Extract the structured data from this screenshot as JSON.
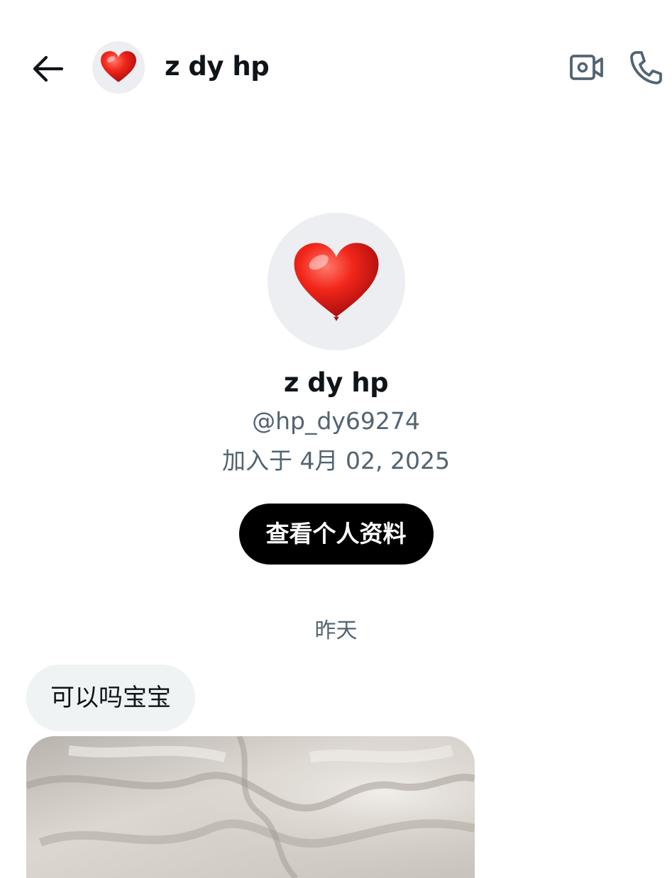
{
  "header": {
    "name": "z dy hp",
    "back_icon": "arrow-left-icon",
    "video_icon": "video-camera-icon",
    "call_icon": "phone-icon"
  },
  "profile": {
    "avatar_icon": "red-heart-icon",
    "name": "z dy hp",
    "handle": "@hp_dy69274",
    "joined": "加入于 4月 02, 2025",
    "view_profile_label": "查看个人资料"
  },
  "conversation": {
    "date_label": "昨天",
    "messages": [
      {
        "text": "可以吗宝宝"
      }
    ]
  },
  "colors": {
    "secondary_text": "#536471",
    "bubble_bg": "#eff3f4",
    "avatar_bg": "#eceef1",
    "heart": "#e2231a",
    "button_bg": "#000000"
  }
}
